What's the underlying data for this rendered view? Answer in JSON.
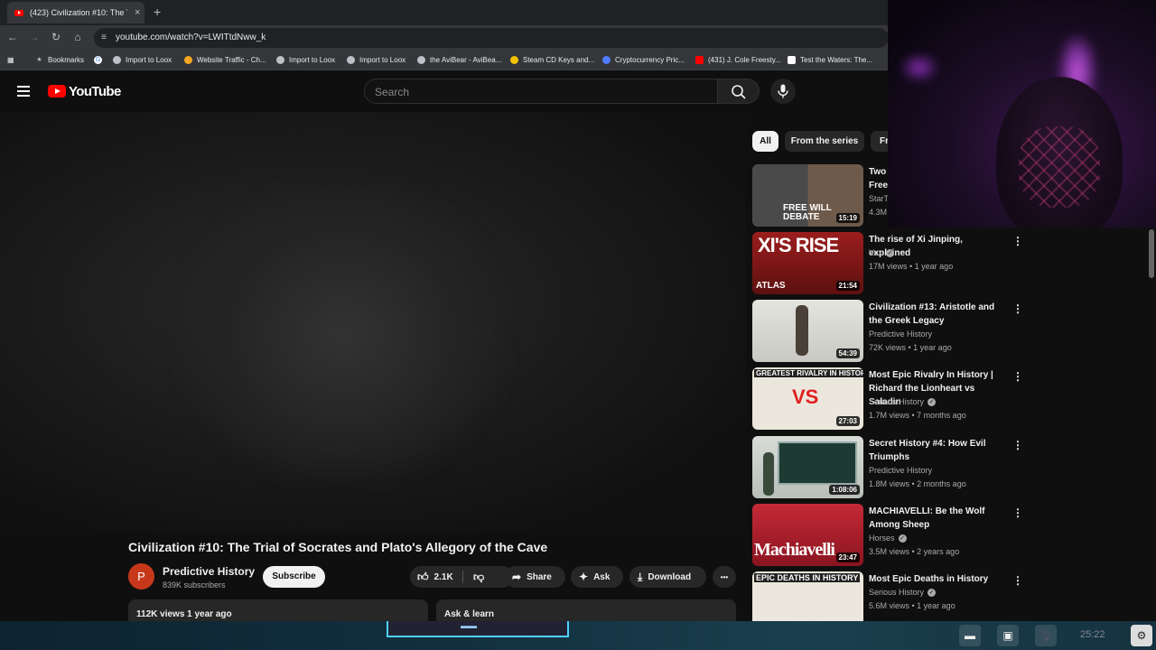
{
  "browser": {
    "tab_title": "(423) Civilization #10: The Trial",
    "tab_close": "×",
    "new_tab": "+",
    "url": "youtube.com/watch?v=LWITtdNww_k",
    "bookmarks": [
      {
        "label": "Bookmarks",
        "color": "#bdc1c6"
      },
      {
        "label": "",
        "color": "#ffffff"
      },
      {
        "label": "Import to Loox",
        "color": "#bdc1c6"
      },
      {
        "label": "Website Traffic - Ch...",
        "color": "#f5a623"
      },
      {
        "label": "Import to Loox",
        "color": "#bdc1c6"
      },
      {
        "label": "Import to Loox",
        "color": "#bdc1c6"
      },
      {
        "label": "the AviBear - AviBea...",
        "color": "#bdc1c6"
      },
      {
        "label": "Steam CD Keys and...",
        "color": "#f2c200"
      },
      {
        "label": "Cryptocurrency Pric...",
        "color": "#4e7cff"
      },
      {
        "label": "(431) J. Cole Freesty...",
        "color": "#ff0000"
      },
      {
        "label": "Test the Waters: The...",
        "color": "#ffffff"
      }
    ]
  },
  "youtube": {
    "logo_text": "YouTube",
    "search_placeholder": "Search"
  },
  "video": {
    "title": "Civilization #10: The Trial of Socrates and Plato's Allegory of the Cave",
    "channel_initial": "P",
    "channel_name": "Predictive History",
    "subscribers": "839K subscribers",
    "subscribe_label": "Subscribe",
    "likes": "2.1K",
    "share_label": "Share",
    "ask_label": "Ask",
    "download_label": "Download",
    "more_label": "•••",
    "views_date": "112K views  1 year ago",
    "ask_learn": "Ask & learn"
  },
  "chips": [
    "All",
    "From the series",
    "Fr"
  ],
  "recommendations": [
    {
      "title": "Two\nFree",
      "channel": "StarT",
      "meta": "4.3M",
      "duration": "15:19",
      "thumb_text": "FREE WILL\nDEBATE",
      "thumb_color": "#3a3a3a",
      "verified": false
    },
    {
      "title": "The rise of Xi Jinping, explained",
      "channel": "Vox",
      "meta": "17M views • 1 year ago",
      "duration": "21:54",
      "thumb_text": "XI'S RISE",
      "thumb_color": "#8b1c1c",
      "verified": true
    },
    {
      "title": "Civilization #13:  Aristotle and the Greek Legacy",
      "channel": "Predictive History",
      "meta": "72K views • 1 year ago",
      "duration": "54:39",
      "thumb_text": "",
      "thumb_color": "#d7d7d2",
      "verified": false
    },
    {
      "title": "Most Epic Rivalry In History | Richard the Lionheart vs Saladin",
      "channel": "Serious History",
      "meta": "1.7M views • 7 months ago",
      "duration": "27:03",
      "thumb_text": "GREATEST RIVALRY IN HISTORY",
      "thumb_color": "#e9e4d8",
      "verified": true
    },
    {
      "title": "Secret History #4:  How Evil Triumphs",
      "channel": "Predictive History",
      "meta": "1.8M views • 2 months ago",
      "duration": "1:08:06",
      "thumb_text": "",
      "thumb_color": "#1f3a34",
      "verified": false
    },
    {
      "title": "MACHIAVELLI: Be the Wolf Among Sheep",
      "channel": "Horses",
      "meta": "3.5M views • 2 years ago",
      "duration": "23:47",
      "thumb_text": "Machiavelli",
      "thumb_color": "#b21f2b",
      "verified": true
    },
    {
      "title": "Most Epic Deaths in History",
      "channel": "Serious History",
      "meta": "5.6M views • 1 year ago",
      "duration": "",
      "thumb_text": "EPIC DEATHS IN HISTORY",
      "thumb_color": "#ece7dc",
      "verified": true
    }
  ],
  "taskbar": {
    "time": "25:22"
  }
}
